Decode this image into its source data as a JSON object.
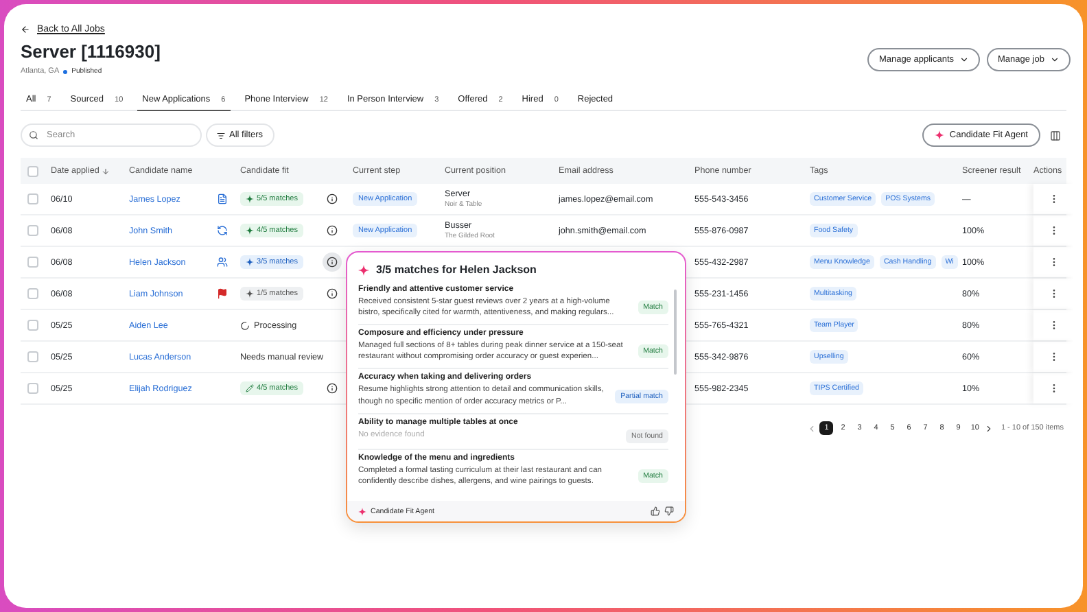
{
  "back_link": "Back to All Jobs",
  "title": "Server [1116930]",
  "location": "Atlanta, GA",
  "status": "Published",
  "header_buttons": [
    "Manage applicants",
    "Manage job"
  ],
  "tabs": [
    {
      "label": "All",
      "count": "7",
      "selected": false
    },
    {
      "label": "Sourced",
      "count": "10",
      "selected": false
    },
    {
      "label": "New Applications",
      "count": "6",
      "selected": true
    },
    {
      "label": "Phone Interview",
      "count": "12",
      "selected": false
    },
    {
      "label": "In Person Interview",
      "count": "3",
      "selected": false
    },
    {
      "label": "Offered",
      "count": "2",
      "selected": false
    },
    {
      "label": "Hired",
      "count": "0",
      "selected": false
    },
    {
      "label": "Rejected",
      "selected": false
    }
  ],
  "search": {
    "placeholder": "Search"
  },
  "filter_button": "All filters",
  "agent_button": "Candidate Fit Agent",
  "table": {
    "select_all": {
      "checked": false
    },
    "columns": [
      {
        "label": "Date applied",
        "sorted": true
      },
      {
        "label": "Candidate name",
        "sorted": false
      },
      {
        "label": "Candidate fit",
        "sorted": false
      },
      {
        "label": "Current step",
        "sorted": false
      },
      {
        "label": "Current position",
        "sorted": false
      },
      {
        "label": "Email address",
        "sorted": false
      },
      {
        "label": "Phone number",
        "sorted": false
      },
      {
        "label": "Tags",
        "sorted": false
      },
      {
        "label": "Screener result",
        "sorted": false
      },
      {
        "label": "Actions",
        "sorted": false
      }
    ],
    "rows": [
      {
        "checked": false,
        "date": "06/10",
        "name": "James Lopez",
        "flag": {
          "kind": "document"
        },
        "fit": {
          "kind": "strong",
          "label": "5/5 matches",
          "edited": false
        },
        "info": {
          "selected": false
        },
        "step": "New Application",
        "position": "Server",
        "employer": "Noir & Table",
        "email": "james.lopez@email.com",
        "phone": "555-543-3456",
        "tags": [
          "Customer Service",
          "POS Systems"
        ],
        "screener": "—"
      },
      {
        "checked": false,
        "date": "06/08",
        "name": "John Smith",
        "flag": {
          "kind": "refresh"
        },
        "fit": {
          "kind": "strong",
          "label": "4/5 matches",
          "edited": false
        },
        "info": {
          "selected": false
        },
        "step": "New Application",
        "position": "Busser",
        "employer": "The Gilded Root",
        "email": "john.smith@email.com",
        "phone": "555-876-0987",
        "tags": [
          "Food Safety"
        ],
        "screener": "100%"
      },
      {
        "checked": false,
        "date": "06/08",
        "name": "Helen Jackson",
        "flag": {
          "kind": "people"
        },
        "fit": {
          "kind": "medium",
          "label": "3/5 matches",
          "edited": false
        },
        "info": {
          "selected": true
        },
        "phone": "555-432-2987",
        "tags": [
          "Menu Knowledge",
          "Cash Handling",
          "Wi"
        ],
        "screener": "100%"
      },
      {
        "checked": false,
        "date": "06/08",
        "name": "Liam Johnson",
        "flag": {
          "kind": "flag"
        },
        "fit": {
          "kind": "weak",
          "label": "1/5 matches",
          "edited": false
        },
        "info": {
          "selected": false
        },
        "phone": "555-231-1456",
        "tags": [
          "Multitasking"
        ],
        "screener": "80%"
      },
      {
        "checked": false,
        "date": "05/25",
        "name": "Aiden Lee",
        "fit": {
          "kind": "processing",
          "label": "Processing"
        },
        "phone": "555-765-4321",
        "tags": [
          "Team Player"
        ],
        "screener": "80%"
      },
      {
        "checked": false,
        "date": "05/25",
        "name": "Lucas Anderson",
        "fit": {
          "kind": "note",
          "label": "Needs manual review"
        },
        "phone": "555-342-9876",
        "tags": [
          "Upselling"
        ],
        "screener": "60%"
      },
      {
        "checked": false,
        "date": "05/25",
        "name": "Elijah Rodriguez",
        "fit": {
          "kind": "strong",
          "label": "4/5 matches",
          "edited": true
        },
        "info": {
          "selected": false
        },
        "phone": "555-982-2345",
        "tags": [
          "TIPS Certified"
        ],
        "screener": "10%"
      }
    ]
  },
  "popover": {
    "title": "3/5 matches for Helen Jackson",
    "footer": "Candidate Fit Agent",
    "items": [
      {
        "title": "Friendly and attentive customer service",
        "text": "Received consistent 5-star guest reviews over 2 years at a high-volume bistro, specifically cited for warmth, attentiveness, and making regulars...",
        "found": true,
        "status": {
          "kind": "match",
          "label": "Match"
        }
      },
      {
        "title": "Composure and efficiency under pressure",
        "text": "Managed full sections of 8+ tables during peak dinner service at a 150-seat restaurant without compromising order accuracy or guest experien...",
        "found": true,
        "status": {
          "kind": "match",
          "label": "Match"
        }
      },
      {
        "title": "Accuracy when taking and delivering orders",
        "text": "Resume highlights strong attention to detail and communication skills, though no specific mention of order accuracy metrics or P...",
        "found": true,
        "status": {
          "kind": "partial",
          "label": "Partial match"
        }
      },
      {
        "title": "Ability to manage multiple tables at once",
        "text": "No evidence found",
        "found": false,
        "status": {
          "kind": "none",
          "label": "Not found"
        }
      },
      {
        "title": "Knowledge of the menu and ingredients",
        "text": "Completed a formal tasting curriculum at their last restaurant and can confidently describe dishes, allergens, and wine pairings to guests.",
        "found": true,
        "status": {
          "kind": "match",
          "label": "Match"
        }
      }
    ]
  },
  "pagination": {
    "pages": [
      {
        "label": "1",
        "selected": true
      },
      {
        "label": "2",
        "selected": false
      },
      {
        "label": "3",
        "selected": false
      },
      {
        "label": "4",
        "selected": false
      },
      {
        "label": "5",
        "selected": false
      },
      {
        "label": "6",
        "selected": false
      },
      {
        "label": "7",
        "selected": false
      },
      {
        "label": "8",
        "selected": false
      },
      {
        "label": "9",
        "selected": false
      },
      {
        "label": "10",
        "selected": false
      }
    ],
    "summary": "1 - 10 of 150 items"
  }
}
